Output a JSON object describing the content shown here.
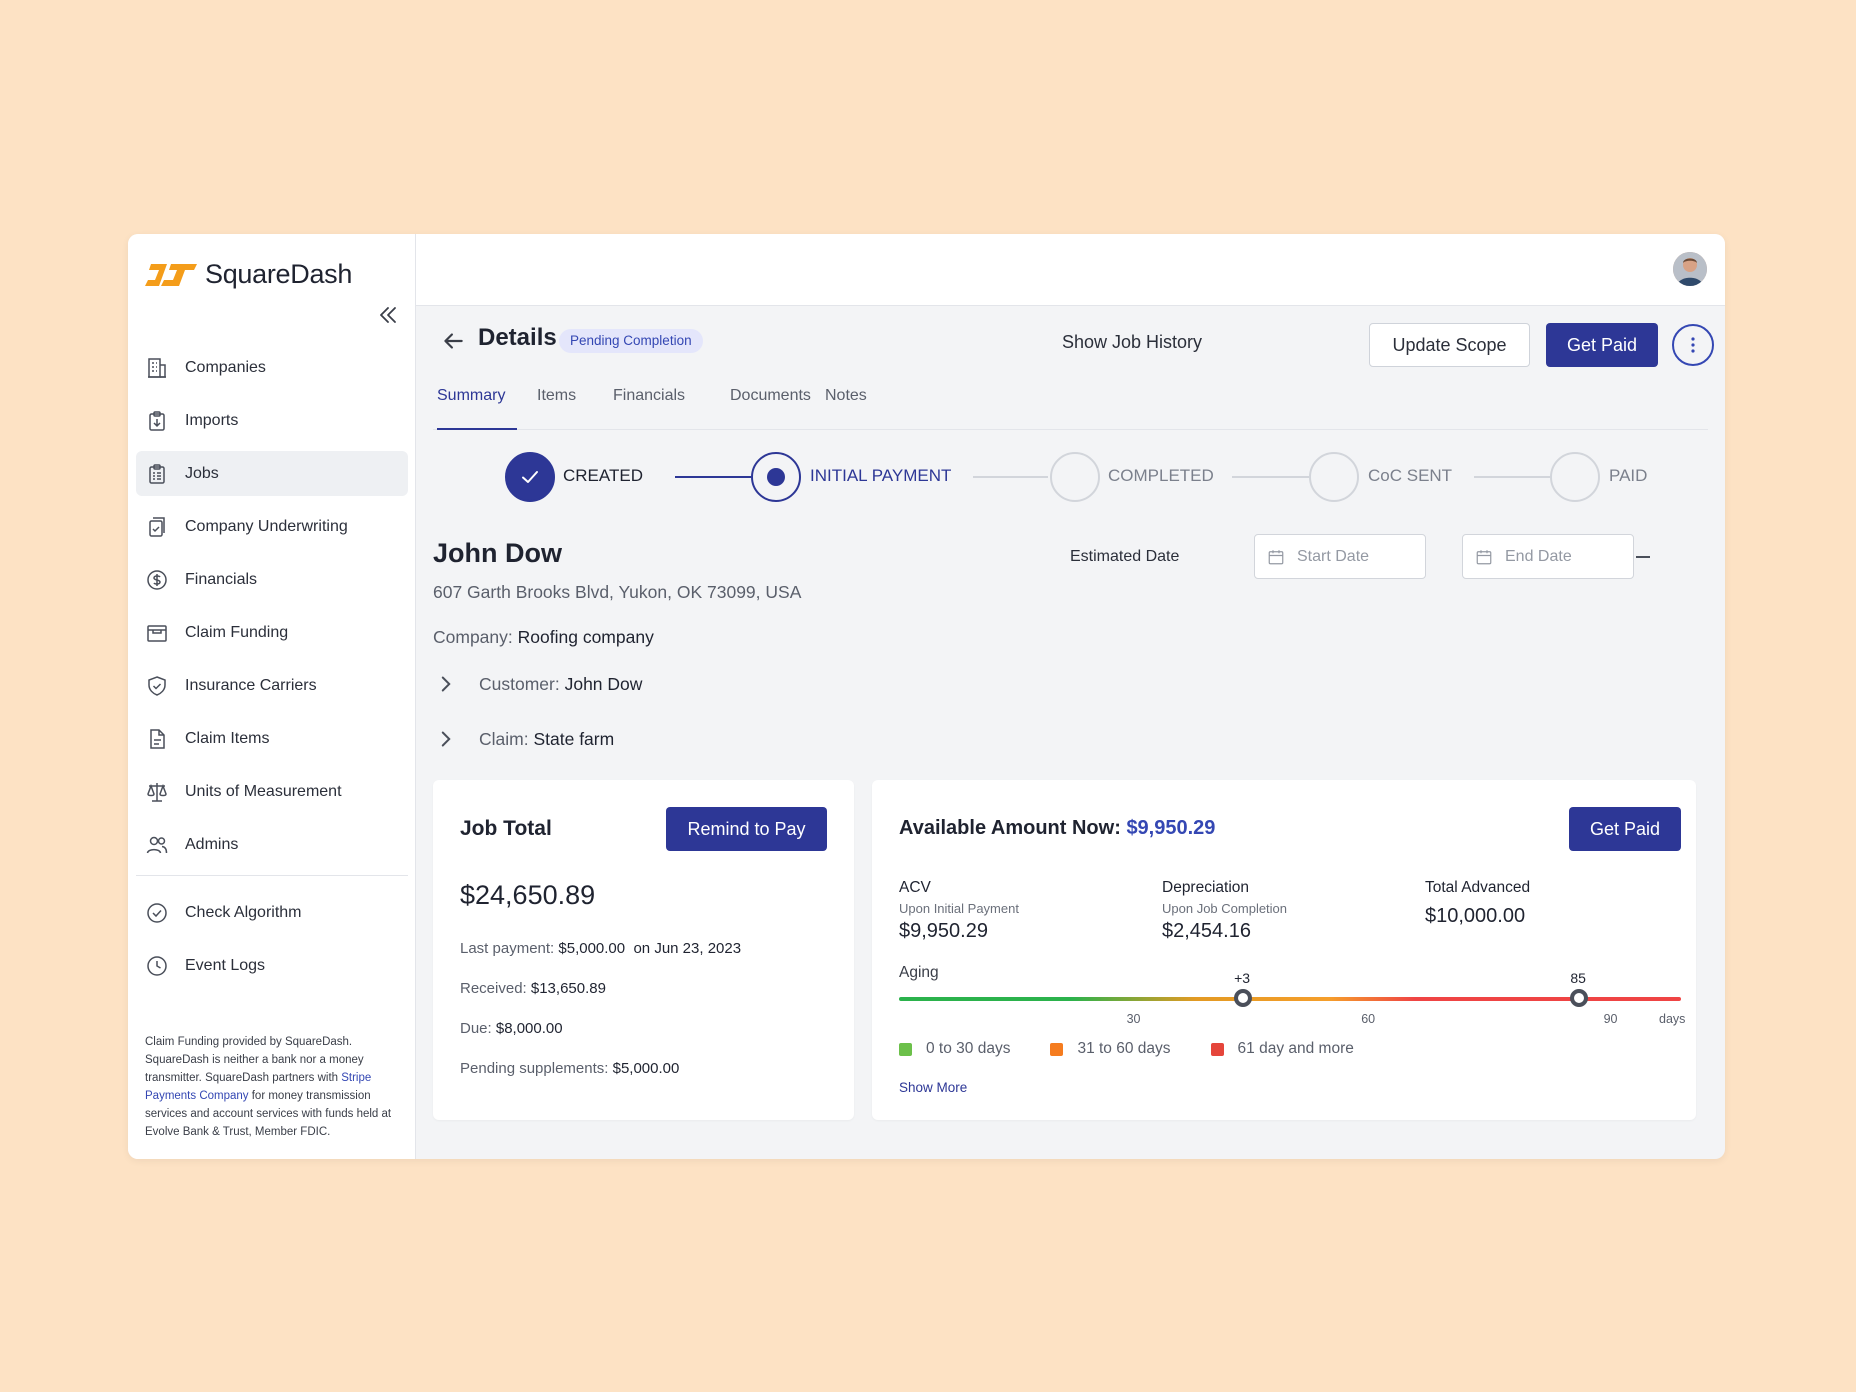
{
  "brand": {
    "name": "SquareDash",
    "accent": "#f49d1a",
    "primary": "#2d3796"
  },
  "sidebar": {
    "items": [
      {
        "label": "Companies",
        "icon": "building-icon"
      },
      {
        "label": "Imports",
        "icon": "clipboard-import-icon"
      },
      {
        "label": "Jobs",
        "icon": "clipboard-list-icon",
        "active": true
      },
      {
        "label": "Company Underwriting",
        "icon": "document-check-icon"
      },
      {
        "label": "Financials",
        "icon": "dollar-circle-icon"
      },
      {
        "label": "Claim Funding",
        "icon": "archive-box-icon"
      },
      {
        "label": "Insurance Carriers",
        "icon": "shield-check-icon"
      },
      {
        "label": "Claim Items",
        "icon": "document-icon"
      },
      {
        "label": "Units of Measurement",
        "icon": "scale-icon"
      },
      {
        "label": "Admins",
        "icon": "users-icon"
      }
    ],
    "secondary": [
      {
        "label": "Check Algorithm",
        "icon": "check-circle-icon"
      },
      {
        "label": "Event Logs",
        "icon": "clock-icon"
      }
    ],
    "disclaimer": {
      "pre": "Claim Funding provided by SquareDash. SquareDash is neither a bank nor a money transmitter. SquareDash partners with ",
      "link": "Stripe Payments Company",
      "post": " for money transmission services and account services with funds held at Evolve Bank & Trust, Member FDIC."
    }
  },
  "header": {
    "title": "Details",
    "status_badge": "Pending Completion",
    "show_history": "Show Job History",
    "update_scope": "Update Scope",
    "get_paid": "Get Paid"
  },
  "tabs": [
    "Summary",
    "Items",
    "Financials",
    "Documents",
    "Notes"
  ],
  "steps": [
    "CREATED",
    "INITIAL PAYMENT",
    "COMPLETED",
    "CoC SENT",
    "PAID"
  ],
  "job": {
    "name": "John Dow",
    "address": "607 Garth Brooks Blvd, Yukon, OK 73099, USA",
    "company_label": "Company:",
    "company": "Roofing company",
    "customer_label": "Customer:",
    "customer": "John Dow",
    "claim_label": "Claim:",
    "claim": "State farm"
  },
  "estimated_date": {
    "label": "Estimated Date",
    "start_placeholder": "Start Date",
    "end_placeholder": "End Date"
  },
  "job_total": {
    "title": "Job Total",
    "remind": "Remind to Pay",
    "amount": "$24,650.89",
    "last_payment_label": "Last payment:",
    "last_payment": "$5,000.00",
    "last_payment_date": "on Jun 23, 2023",
    "received_label": "Received:",
    "received": "$13,650.89",
    "due_label": "Due:",
    "due": "$8,000.00",
    "pending_label": "Pending supplements:",
    "pending": "$5,000.00"
  },
  "available": {
    "title": "Available Amount Now:",
    "amount": "$9,950.29",
    "get_paid": "Get Paid",
    "acv": {
      "h": "ACV",
      "sub": "Upon Initial Payment",
      "v": "$9,950.29"
    },
    "depreciation": {
      "h": "Depreciation",
      "sub": "Upon Job Completion",
      "v": "$2,454.16"
    },
    "total_advanced": {
      "h": "Total Advanced",
      "v": "$10,000.00"
    },
    "aging_label": "Aging",
    "aging": {
      "min": 0,
      "max": 100,
      "marker1": 44,
      "marker1_label": "+3",
      "marker2": 87,
      "marker2_label": "85"
    },
    "ticks": [
      {
        "v": 30,
        "label": "30"
      },
      {
        "v": 60,
        "label": "60"
      },
      {
        "v": 91,
        "label": "90"
      }
    ],
    "days_label": "days",
    "legend": [
      {
        "label": "0 to 30 days",
        "color": "#6cc04a"
      },
      {
        "label": "31 to 60 days",
        "color": "#f57c1f"
      },
      {
        "label": "61 day and more",
        "color": "#e5453b"
      }
    ],
    "show_more": "Show More"
  }
}
